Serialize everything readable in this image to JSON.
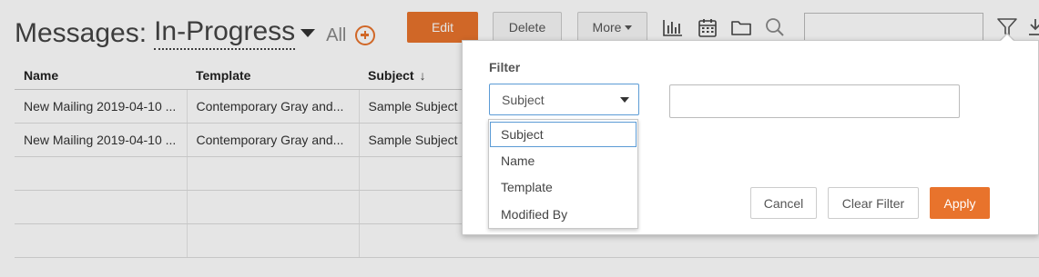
{
  "header": {
    "title_prefix": "Messages:",
    "status": "In-Progress",
    "all_link": "All"
  },
  "toolbar": {
    "edit_label": "Edit",
    "delete_label": "Delete",
    "more_label": "More"
  },
  "icons": {
    "chart": "bar-chart-icon",
    "calendar": "calendar-icon",
    "folder": "folder-icon",
    "search": "search-icon",
    "filter": "filter-icon",
    "download": "download-icon"
  },
  "table": {
    "columns": [
      "Name",
      "Template",
      "Subject"
    ],
    "rows": [
      [
        "New Mailing 2019-04-10 ...",
        "Contemporary Gray and...",
        "Sample Subject"
      ],
      [
        "New Mailing 2019-04-10 ...",
        "Contemporary Gray and...",
        "Sample Subject"
      ]
    ]
  },
  "filter_popup": {
    "label": "Filter",
    "selected_field": "Subject",
    "options": [
      "Subject",
      "Name",
      "Template",
      "Modified By"
    ],
    "value": "",
    "cancel_label": "Cancel",
    "clear_label": "Clear Filter",
    "apply_label": "Apply"
  },
  "colors": {
    "accent": "#e8732c",
    "focus": "#5b9bd5"
  }
}
